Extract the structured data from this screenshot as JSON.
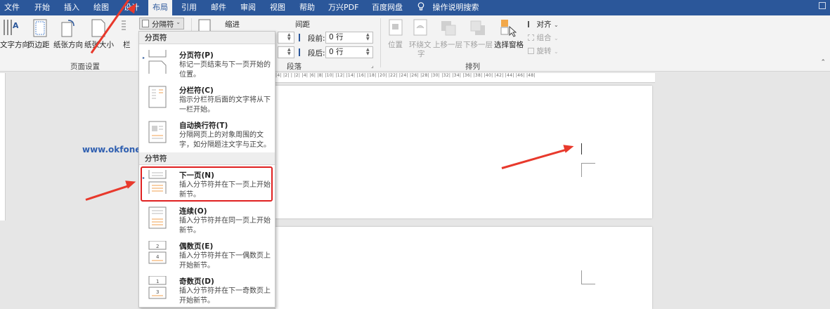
{
  "tabs": [
    {
      "label": "文件",
      "active": false
    },
    {
      "label": "开始",
      "active": false
    },
    {
      "label": "插入",
      "active": false
    },
    {
      "label": "绘图",
      "active": false
    },
    {
      "label": "设计",
      "active": false
    },
    {
      "label": "布局",
      "active": true
    },
    {
      "label": "引用",
      "active": false
    },
    {
      "label": "邮件",
      "active": false
    },
    {
      "label": "审阅",
      "active": false
    },
    {
      "label": "视图",
      "active": false
    },
    {
      "label": "帮助",
      "active": false
    },
    {
      "label": "万兴PDF",
      "active": false
    },
    {
      "label": "百度网盘",
      "active": false
    }
  ],
  "tell_me": {
    "icon": "lightbulb-icon",
    "label": "操作说明搜索"
  },
  "ribbon": {
    "page_setup": {
      "text_direction": "文字方向",
      "margins": "页边距",
      "orientation": "纸张方向",
      "size": "纸张大小",
      "columns": "栏",
      "breaks": "分隔符",
      "group_label": "页面设置"
    },
    "paragraph": {
      "indent_label": "缩进",
      "spacing_label": "间距",
      "before_label": "段前:",
      "before_value": "0 行",
      "after_label": "段后:",
      "after_value": "0 行",
      "group_label": "段落"
    },
    "arrange": {
      "position": "位置",
      "wrap_text_1": "环绕文",
      "wrap_text_2": "字",
      "bring_forward": "上移一层",
      "send_backward": "下移一层",
      "selection_pane": "选择窗格",
      "align": "对齐",
      "group": "组合",
      "rotate": "旋转",
      "group_label": "排列"
    }
  },
  "ruler_text": "|4| |2| | |2| |4| |6| |8| |10| |12| |14| |16| |18| |20| |22| |24| |26| |28| |30| |32| |34| |36| |38| |40| |42| |44| |46| |48|",
  "dropdown": {
    "page_breaks_header": "分页符",
    "page_break_items": [
      {
        "title": "分页符(P)",
        "desc": "标记一页结束与下一页开始的位置。",
        "icon": "page-break-icon"
      },
      {
        "title": "分栏符(C)",
        "desc": "指示分栏符后面的文字将从下一栏开始。",
        "icon": "column-break-icon"
      },
      {
        "title": "自动换行符(T)",
        "desc": "分隔网页上的对象周围的文字，如分隔题注文字与正文。",
        "icon": "text-wrapping-break-icon"
      }
    ],
    "section_breaks_header": "分节符",
    "section_break_items": [
      {
        "title": "下一页(N)",
        "desc": "插入分节符并在下一页上开始新节。",
        "icon": "next-page-break-icon"
      },
      {
        "title": "连续(O)",
        "desc": "插入分节符并在同一页上开始新节。",
        "icon": "continuous-break-icon"
      },
      {
        "title": "偶数页(E)",
        "desc": "插入分节符并在下一偶数页上开始新节。",
        "icon": "even-page-break-icon"
      },
      {
        "title": "奇数页(D)",
        "desc": "插入分节符并在下一奇数页上开始新节。",
        "icon": "odd-page-break-icon"
      }
    ]
  },
  "watermark": "www.okfone.com",
  "colors": {
    "title_bar": "#2b579a",
    "ribbon": "#f3f3f3",
    "highlight": "#e02020",
    "arrow": "#e8392c",
    "watermark": "#2f5fb0"
  }
}
